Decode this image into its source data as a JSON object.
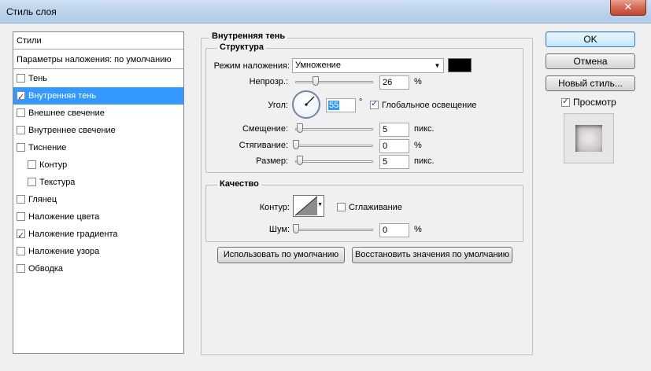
{
  "window": {
    "title": "Стиль слоя"
  },
  "styles_list": {
    "header": "Стили",
    "blend_default": "Параметры наложения: по умолчанию",
    "items": [
      {
        "label": "Тень",
        "checked": false,
        "indent": false,
        "selected": false
      },
      {
        "label": "Внутренняя тень",
        "checked": true,
        "indent": false,
        "selected": true
      },
      {
        "label": "Внешнее свечение",
        "checked": false,
        "indent": false,
        "selected": false
      },
      {
        "label": "Внутреннее свечение",
        "checked": false,
        "indent": false,
        "selected": false
      },
      {
        "label": "Тиснение",
        "checked": false,
        "indent": false,
        "selected": false
      },
      {
        "label": "Контур",
        "checked": false,
        "indent": true,
        "selected": false
      },
      {
        "label": "Текстура",
        "checked": false,
        "indent": true,
        "selected": false
      },
      {
        "label": "Глянец",
        "checked": false,
        "indent": false,
        "selected": false
      },
      {
        "label": "Наложение цвета",
        "checked": false,
        "indent": false,
        "selected": false
      },
      {
        "label": "Наложение градиента",
        "checked": true,
        "indent": false,
        "selected": false
      },
      {
        "label": "Наложение узора",
        "checked": false,
        "indent": false,
        "selected": false
      },
      {
        "label": "Обводка",
        "checked": false,
        "indent": false,
        "selected": false
      }
    ]
  },
  "inner_shadow": {
    "title": "Внутренняя тень",
    "structure": {
      "title": "Структура",
      "blend_mode_label": "Режим наложения:",
      "blend_mode_value": "Умножение",
      "blend_color": "#000000",
      "opacity_label": "Непрозр.:",
      "opacity_value": "26",
      "opacity_unit": "%",
      "opacity_level": 26,
      "angle_label": "Угол:",
      "angle_value": "55",
      "angle_unit": "°",
      "global_light_label": "Глобальное освещение",
      "global_light_checked": true,
      "distance_label": "Смещение:",
      "distance_value": "5",
      "distance_unit": "пикс.",
      "choke_label": "Стягивание:",
      "choke_value": "0",
      "choke_unit": "%",
      "size_label": "Размер:",
      "size_value": "5",
      "size_unit": "пикс."
    },
    "quality": {
      "title": "Качество",
      "contour_label": "Контур:",
      "antialias_label": "Сглаживание",
      "antialias_checked": false,
      "noise_label": "Шум:",
      "noise_value": "0",
      "noise_unit": "%"
    },
    "make_default_label": "Использовать по умолчанию",
    "reset_default_label": "Восстановить значения по умолчанию"
  },
  "buttons": {
    "ok": "OK",
    "cancel": "Отмена",
    "new_style": "Новый стиль...",
    "preview_label": "Просмотр",
    "preview_checked": true
  }
}
